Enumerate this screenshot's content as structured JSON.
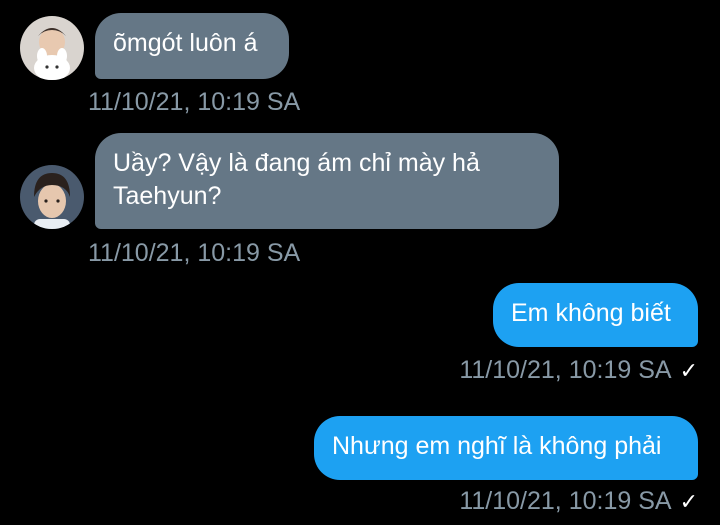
{
  "messages": [
    {
      "direction": "incoming",
      "avatar_icon": "user-avatar-plush-icon",
      "text": "õmgót luôn á",
      "timestamp": "11/10/21, 10:19 SA"
    },
    {
      "direction": "incoming",
      "avatar_icon": "user-avatar-boy-icon",
      "text": "Uầy? Vậy là đang ám chỉ mày hả Taehyun?",
      "timestamp": "11/10/21, 10:19 SA"
    },
    {
      "direction": "outgoing",
      "text": "Em không biết",
      "timestamp": "11/10/21, 10:19 SA",
      "status_icon": "checkmark-icon"
    },
    {
      "direction": "outgoing",
      "text": "Nhưng em nghĩ là không phải",
      "timestamp": "11/10/21, 10:19 SA",
      "status_icon": "checkmark-icon"
    }
  ],
  "colors": {
    "background": "#000000",
    "incoming_bubble": "#657786",
    "outgoing_bubble": "#1da1f2",
    "timestamp": "#8899a6"
  }
}
